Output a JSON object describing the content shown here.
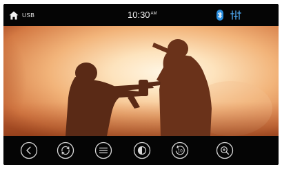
{
  "status_bar": {
    "source": "USB",
    "time": "10:30",
    "ampm": "AM",
    "icons": [
      "home-icon",
      "bluetooth-icon",
      "equalizer-icon"
    ],
    "bluetooth_color": "#2b8fe0"
  },
  "video": {
    "content": "video-frame-soldiers-silhouette"
  },
  "controls": [
    {
      "name": "back-button",
      "icon": "chevron-left-icon"
    },
    {
      "name": "repeat-button",
      "icon": "repeat-icon"
    },
    {
      "name": "playlist-button",
      "icon": "list-icon"
    },
    {
      "name": "brightness-button",
      "icon": "contrast-icon"
    },
    {
      "name": "rewind-10-button",
      "icon": "replay-10-icon"
    },
    {
      "name": "zoom-button",
      "icon": "zoom-in-icon"
    }
  ],
  "colors": {
    "background": "#060606",
    "icon": "#d8d8d8"
  }
}
